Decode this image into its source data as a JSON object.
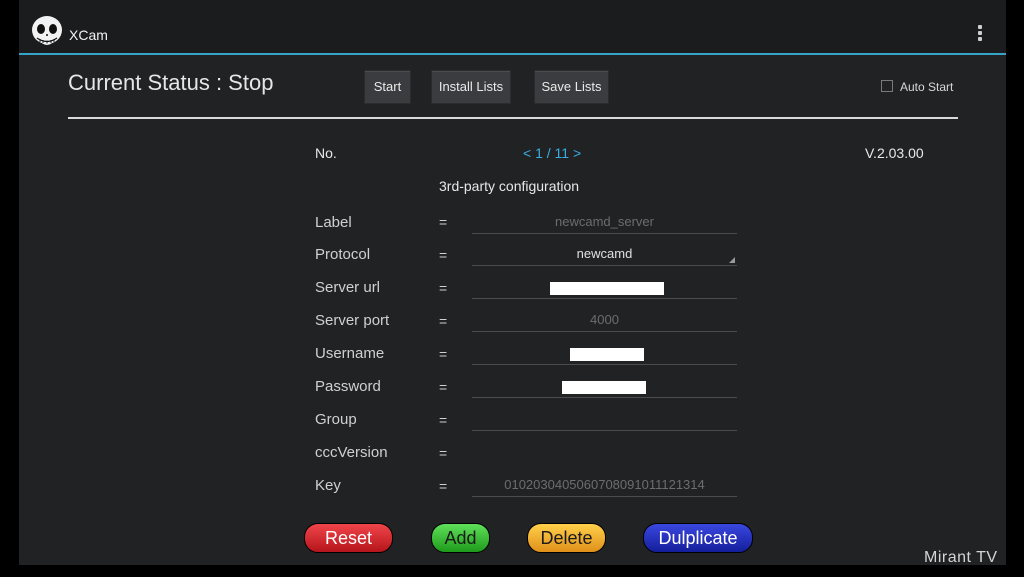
{
  "app": {
    "title": "XCam",
    "icon": "skull-icon"
  },
  "header": {
    "status_text": "Current Status : Stop",
    "buttons": {
      "start": "Start",
      "install": "Install Lists",
      "save": "Save Lists"
    },
    "auto_start_label": "Auto Start",
    "auto_start_checked": false
  },
  "info": {
    "no_label": "No.",
    "pager": "< 1 / 11 >",
    "version": "V.2.03.00"
  },
  "section_title": "3rd-party configuration",
  "form": {
    "separator": "=",
    "label": {
      "label": "Label",
      "hint": "newcamd_server"
    },
    "protocol": {
      "label": "Protocol",
      "value": "newcamd"
    },
    "server_url": {
      "label": "Server url"
    },
    "server_port": {
      "label": "Server port",
      "hint": "4000"
    },
    "username": {
      "label": "Username"
    },
    "password": {
      "label": "Password"
    },
    "group": {
      "label": "Group"
    },
    "ccc_version": {
      "label": "cccVersion"
    },
    "key": {
      "label": "Key",
      "hint": "0102030405060708091011121314"
    }
  },
  "actions": {
    "reset": {
      "label": "Reset",
      "color": "#d9232a"
    },
    "add": {
      "label": "Add",
      "color": "#2fb52a"
    },
    "delete": {
      "label": "Delete",
      "color": "#f0a81c"
    },
    "duplicate": {
      "label": "Dulplicate",
      "color": "#1c2bb8"
    }
  },
  "colors": {
    "accent": "#36a3c9",
    "background": "#202224"
  },
  "watermark": "Mirant TV"
}
